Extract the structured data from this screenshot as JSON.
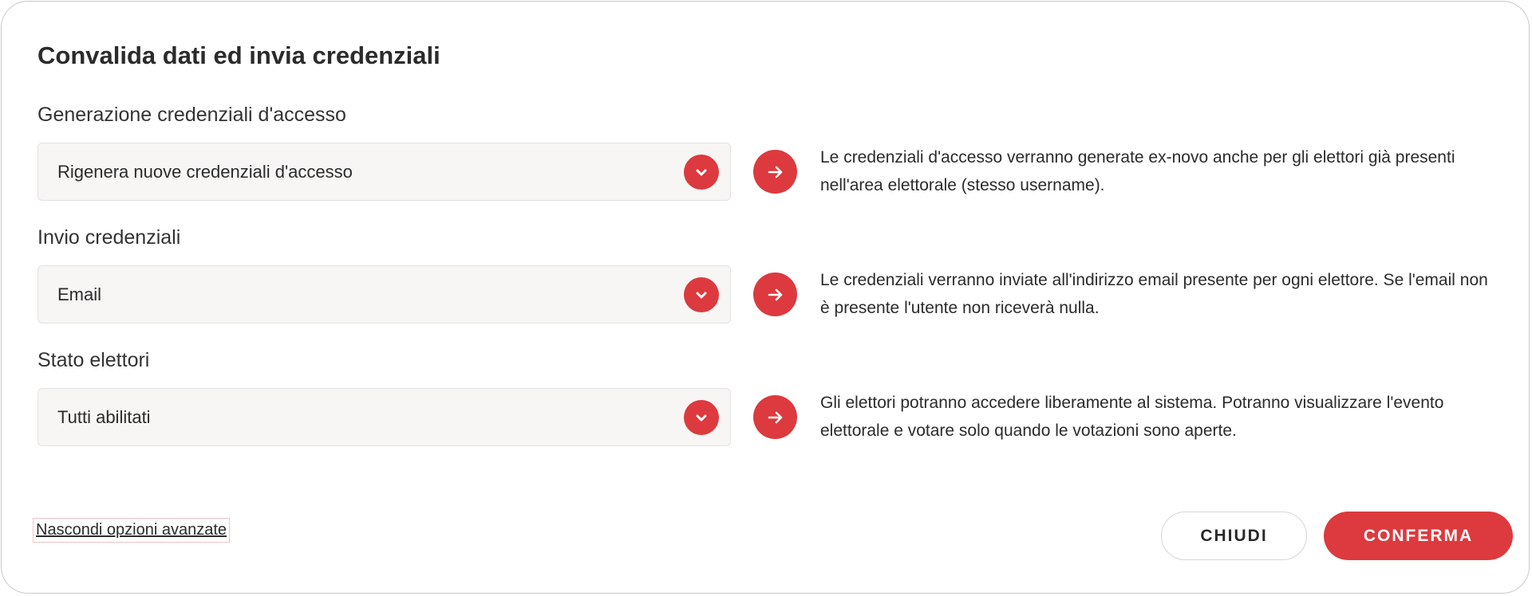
{
  "dialog": {
    "title": "Convalida dati ed invia credenziali"
  },
  "sections": [
    {
      "label": "Generazione credenziali d'accesso",
      "value": "Rigenera nuove credenziali d'accesso",
      "description": "Le credenziali d'accesso verranno generate ex-novo anche per gli elettori già presenti nell'area elettorale (stesso username)."
    },
    {
      "label": "Invio credenziali",
      "value": "Email",
      "description": "Le credenziali verranno inviate all'indirizzo email presente per ogni elettore. Se l'email non è presente l'utente non riceverà nulla."
    },
    {
      "label": "Stato elettori",
      "value": "Tutti abilitati",
      "description": "Gli elettori potranno accedere liberamente al sistema. Potranno visualizzare l'evento elettorale e votare solo quando le votazioni sono aperte."
    }
  ],
  "footer": {
    "advanced_link": "Nascondi opzioni avanzate",
    "close_label": "CHIUDI",
    "confirm_label": "CONFERMA"
  },
  "icons": {
    "select_chevron": "chevron-down-icon",
    "info_arrow": "arrow-right-icon"
  },
  "colors": {
    "accent": "#dc3a3e",
    "field_background": "#f7f6f5",
    "text": "#2b2b2b"
  }
}
